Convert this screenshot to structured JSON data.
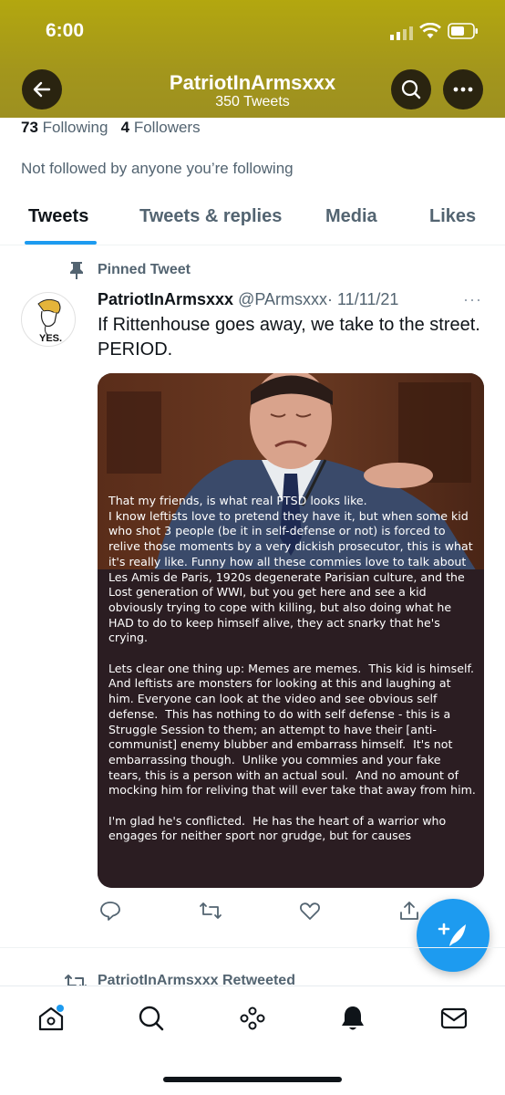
{
  "status_bar": {
    "time": "6:00"
  },
  "header": {
    "name": "PatriotInArmsxxx",
    "tweet_count": "350 Tweets"
  },
  "profile": {
    "following_count": "73",
    "following_label": "Following",
    "followers_count": "4",
    "followers_label": "Followers",
    "not_followed": "Not followed by anyone you’re following"
  },
  "tabs": [
    {
      "label": "Tweets",
      "active": true
    },
    {
      "label": "Tweets & replies",
      "active": false
    },
    {
      "label": "Media",
      "active": false
    },
    {
      "label": "Likes",
      "active": false
    }
  ],
  "tweet": {
    "pinned_label": "Pinned Tweet",
    "display_name": "PatriotInArmsxxx",
    "handle": "@PArmsxxx",
    "date": "· 11/11/21",
    "more": "···",
    "text": "If Rittenhouse goes away, we take to the street. PERIOD.",
    "avatar_text": "YES.",
    "image_text": "That my friends, is what real PTSD looks like.\nI know leftists love to pretend they have it, but when some kid who shot 3 people (be it in self-defense or not) is forced to relive those moments by a very dickish prosecutor, this is what it's really like. Funny how all these commies love to talk about Les Amis de Paris, 1920s degenerate Parisian culture, and the Lost generation of WWI, but you get here and see a kid obviously trying to cope with killing, but also doing what he HAD to do to keep himself alive, they act snarky that he's crying.\n\nLets clear one thing up: Memes are memes.  This kid is himself.  And leftists are monsters for looking at this and laughing at him. Everyone can look at the video and see obvious self defense.  This has nothing to do with self defense - this is a Struggle Session to them; an attempt to have their [anti-communist] enemy blubber and embarrass himself.  It's not embarrassing though.  Unlike you commies and your fake tears, this is a person with an actual soul.  And no amount of mocking him for reliving that will ever take that away from him.\n\nI'm glad he's conflicted.  He has the heart of a warrior who engages for neither sport nor grudge, but for causes"
  },
  "next_item": {
    "retweeted_label": "PatriotInArmsxxx Retweeted"
  },
  "icons": [
    "back-arrow-icon",
    "search-icon",
    "more-icon",
    "pin-icon",
    "reply-icon",
    "retweet-icon",
    "like-icon",
    "share-icon",
    "compose-icon",
    "home-icon",
    "explore-icon",
    "spaces-icon",
    "notifications-icon",
    "messages-icon"
  ],
  "colors": {
    "header": "#a89a18",
    "accent": "#1d9bf0",
    "secondary_text": "#536471"
  }
}
